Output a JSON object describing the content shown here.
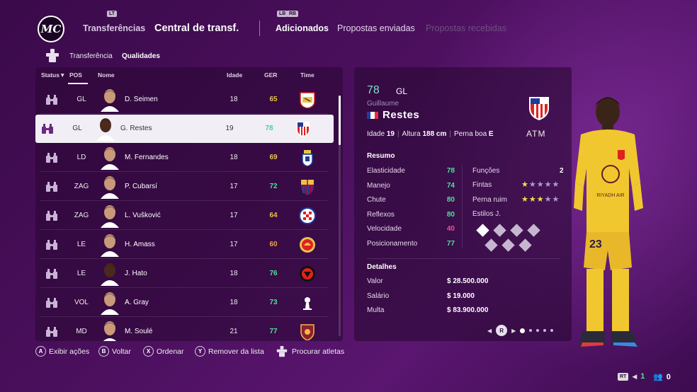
{
  "nav": {
    "lb_hint": "LB",
    "rb_hint": "RB",
    "lt_hint": "LT",
    "logo_text": "MC",
    "transferencias": "Transferências",
    "central": "Central de transf.",
    "adicionados": "Adicionados",
    "propostas_enviadas": "Propostas enviadas",
    "propostas_recebidas": "Propostas recebidas"
  },
  "subnav": {
    "transferencia": "Transferência",
    "qualidades": "Qualidades"
  },
  "table": {
    "headers": {
      "status": "Status▼",
      "pos": "POS",
      "nome": "Nome",
      "idade": "Idade",
      "ger": "GER",
      "time": "Time"
    },
    "rows": [
      {
        "pos": "GL",
        "name": "D. Seimen",
        "age": "18",
        "ovr": "65",
        "ovr_color": "#e9c24b",
        "club": "stuttgart"
      },
      {
        "pos": "GL",
        "name": "G. Restes",
        "age": "19",
        "ovr": "78",
        "ovr_color": "#3fd2a6",
        "club": "atletico"
      },
      {
        "pos": "LD",
        "name": "M. Fernandes",
        "age": "18",
        "ovr": "69",
        "ovr_color": "#e9c24b",
        "club": "laspalmas"
      },
      {
        "pos": "ZAG",
        "name": "P. Cubarsí",
        "age": "17",
        "ovr": "72",
        "ovr_color": "#4ce29a",
        "club": "barcelona"
      },
      {
        "pos": "ZAG",
        "name": "L. Vušković",
        "age": "17",
        "ovr": "64",
        "ovr_color": "#e9c24b",
        "club": "hajduk"
      },
      {
        "pos": "LE",
        "name": "H. Amass",
        "age": "17",
        "ovr": "60",
        "ovr_color": "#e8a548",
        "club": "manutd"
      },
      {
        "pos": "LE",
        "name": "J. Hato",
        "age": "18",
        "ovr": "76",
        "ovr_color": "#4ce29a",
        "club": "leverkusen"
      },
      {
        "pos": "VOL",
        "name": "A. Gray",
        "age": "18",
        "ovr": "73",
        "ovr_color": "#4ce29a",
        "club": "tottenham"
      },
      {
        "pos": "MD",
        "name": "M. Soulé",
        "age": "21",
        "ovr": "77",
        "ovr_color": "#4ce29a",
        "club": "roma"
      }
    ]
  },
  "detail": {
    "ovr": "78",
    "pos": "GL",
    "first_name": "Guillaume",
    "last_name": "Restes",
    "idade_label": "Idade",
    "idade": "19",
    "altura_label": "Altura",
    "altura": "188 cm",
    "perna_label": "Perna boa",
    "perna": "E",
    "club": "ATM",
    "resumo": "Resumo",
    "stats": [
      {
        "label": "Elasticidade",
        "value": "78",
        "color": "#4ce29a"
      },
      {
        "label": "Manejo",
        "value": "74",
        "color": "#4ce29a"
      },
      {
        "label": "Chute",
        "value": "80",
        "color": "#4ce29a"
      },
      {
        "label": "Reflexos",
        "value": "80",
        "color": "#4ce29a"
      },
      {
        "label": "Velocidade",
        "value": "40",
        "color": "#f0509a"
      },
      {
        "label": "Posicionamento",
        "value": "77",
        "color": "#4ce29a"
      }
    ],
    "funcoes_label": "Funções",
    "funcoes_value": "2",
    "fintas_label": "Fintas",
    "fintas_stars": 1,
    "perna_ruim_label": "Perna ruim",
    "perna_ruim_stars": 3,
    "estilos_label": "Estilos J.",
    "detalhes": "Detalhes",
    "valor_label": "Valor",
    "valor": "$ 28.500.000",
    "salario_label": "Salário",
    "salario": "$ 19.000",
    "multa_label": "Multa",
    "multa": "$ 83.900.000",
    "pager_btn": "R"
  },
  "footer": {
    "a_btn": "A",
    "a_label": "Exibir ações",
    "b_btn": "B",
    "b_label": "Voltar",
    "x_btn": "X",
    "x_label": "Ordenar",
    "y_btn": "Y",
    "y_label": "Remover da lista",
    "procurar_label": "Procurar atletas",
    "rt": "RT",
    "count1": "1",
    "count2": "0"
  },
  "kit": {
    "number": "23",
    "sponsor": "RIYADH AIR"
  }
}
